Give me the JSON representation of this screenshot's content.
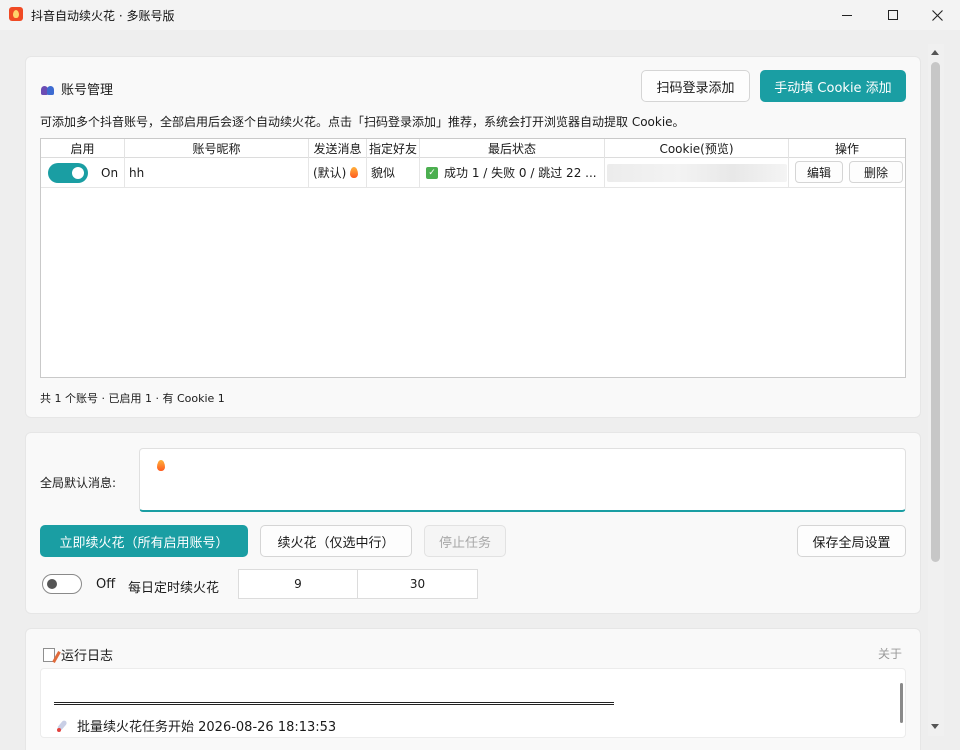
{
  "window": {
    "title": "抖音自动续火花 · 多账号版"
  },
  "accounts": {
    "section_title": "账号管理",
    "qr_add_label": "扫码登录添加",
    "manual_add_label": "手动填 Cookie 添加",
    "hint": "可添加多个抖音账号，全部启用后会逐个自动续火花。点击「扫码登录添加」推荐，系统会打开浏览器自动提取 Cookie。",
    "columns": [
      "启用",
      "账号昵称",
      "发送消息",
      "指定好友",
      "最后状态",
      "Cookie(预览)",
      "操作"
    ],
    "rows": [
      {
        "enabled": true,
        "enabled_label": "On",
        "nickname": "hh",
        "message": "(默认)",
        "friend": "貌似",
        "status": "成功 1 / 失败 0 / 跳过 22 ...",
        "edit_label": "编辑",
        "delete_label": "删除"
      }
    ],
    "summary": "共 1 个账号 · 已启用 1 · 有 Cookie 1"
  },
  "settings": {
    "message_label": "全局默认消息:",
    "run_all_label": "立即续火花（所有启用账号）",
    "run_selected_label": "续火花（仅选中行）",
    "stop_label": "停止任务",
    "save_label": "保存全局设置",
    "schedule_enabled": false,
    "schedule_toggle_label": "Off",
    "schedule_label": "每日定时续火花",
    "hour": "9",
    "minute": "30"
  },
  "log": {
    "section_title": "运行日志",
    "about_label": "关于",
    "entries": [
      {
        "text": "批量续火花任务开始  2026-08-26 18:13:53"
      }
    ]
  }
}
